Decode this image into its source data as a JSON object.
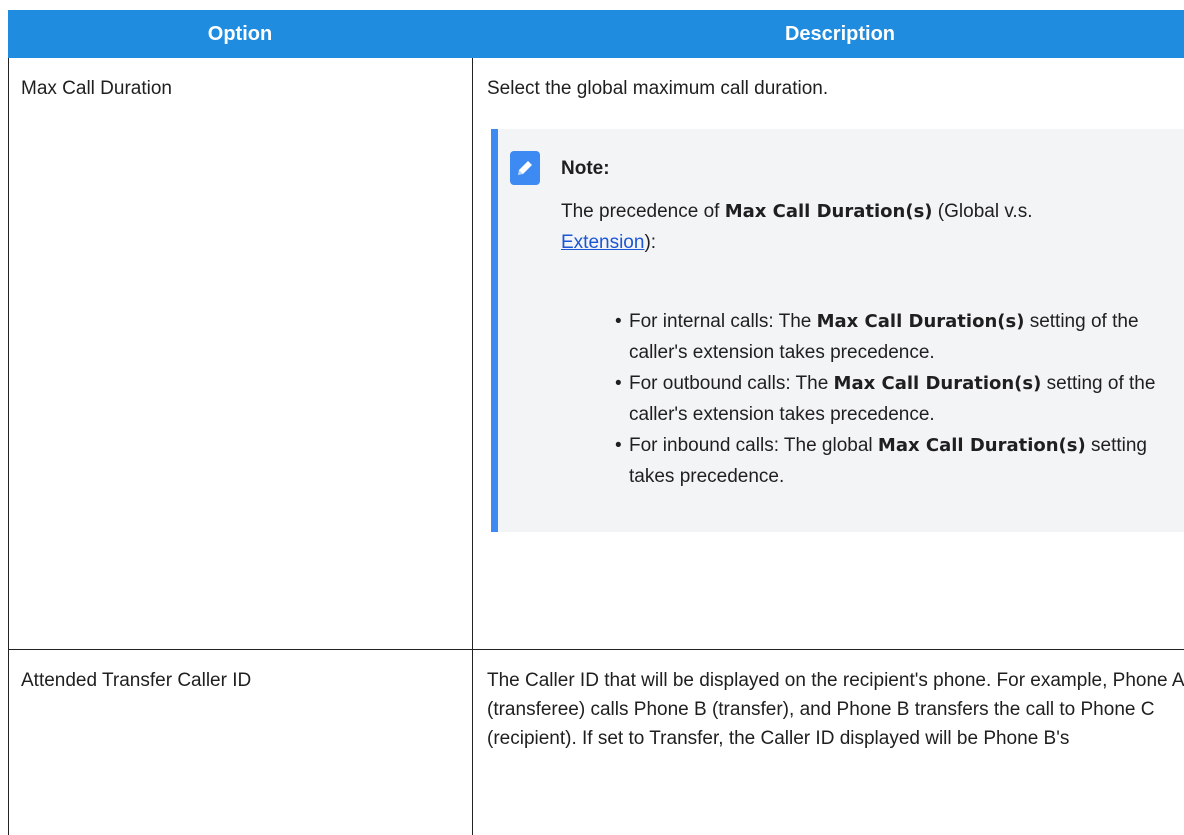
{
  "table": {
    "headers": [
      "Option",
      "Description"
    ],
    "rows": [
      {
        "option": "Max Call Duration",
        "description": "Select the global maximum call duration.",
        "note": {
          "title": "Note:",
          "intro_pre": "The precedence of ",
          "intro_term": "Max Call Duration(s)",
          "intro_mid": " (Global v.s. ",
          "intro_link": "Extension",
          "intro_post": "):",
          "bullets": [
            {
              "pre": "For internal calls: The ",
              "term": "Max Call Duration(s)",
              "post": " setting of the caller's extension takes precedence."
            },
            {
              "pre": "For outbound calls: The ",
              "term": "Max Call Duration(s)",
              "post": " setting of the caller's extension takes precedence."
            },
            {
              "pre": "For inbound calls: The global ",
              "term": "Max Call Duration(s)",
              "post": " setting takes precedence."
            }
          ]
        }
      },
      {
        "option": "Attended Transfer Caller ID",
        "description": "The Caller ID that will be displayed on the recipient's phone. For example, Phone A (transferee) calls Phone B (transfer), and Phone B transfers the call to Phone C (recipient). If set to Transfer, the Caller ID displayed will be Phone B's"
      }
    ]
  },
  "colors": {
    "header_bg": "#1f8ce0",
    "note_accent": "#3d8bf2",
    "link": "#1a56d6"
  },
  "icons": {
    "note": "pencil-note-icon"
  }
}
